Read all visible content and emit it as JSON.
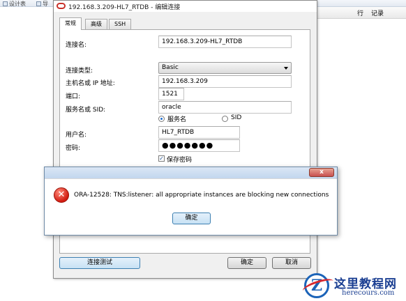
{
  "background": {
    "toolbar_items": [
      "设计表",
      "导"
    ],
    "close_x": "✕",
    "columns": [
      "行",
      "记录"
    ]
  },
  "dialog": {
    "title": "192.168.3.209-HL7_RTDB - 编辑连接",
    "tabs": [
      {
        "label": "常规",
        "active": true
      },
      {
        "label": "高级",
        "active": false
      },
      {
        "label": "SSH",
        "active": false
      }
    ],
    "form": {
      "connection_name_label": "连接名:",
      "connection_name_value": "192.168.3.209-HL7_RTDB",
      "connection_type_label": "连接类型:",
      "connection_type_value": "Basic",
      "host_label": "主机名或 IP 地址:",
      "host_value": "192.168.3.209",
      "port_label": "端口:",
      "port_value": "1521",
      "service_label": "服务名或 SID:",
      "service_value": "oracle",
      "radio_service_name": "服务名",
      "radio_sid": "SID",
      "selected_radio": "service_name",
      "username_label": "用户名:",
      "username_value": "HL7_RTDB",
      "password_label": "密码:",
      "password_value": "●●●●●●●",
      "save_password_label": "保存密码",
      "save_password_checked": true
    },
    "buttons": {
      "test_connection": "连接测试",
      "ok": "确定",
      "cancel": "取消"
    }
  },
  "error_box": {
    "close_label": "x",
    "icon": "error-icon",
    "message": "ORA-12528: TNS:listener: all appropriate instances are blocking new connections",
    "ok_label": "确定"
  },
  "watermark": {
    "logo_letter": "Z",
    "cn": "这里教程网",
    "en": "herecours.com"
  },
  "colors": {
    "accent_blue": "#3c7fb1",
    "error_red": "#d21b10",
    "watermark_blue": "#1b3f92"
  }
}
